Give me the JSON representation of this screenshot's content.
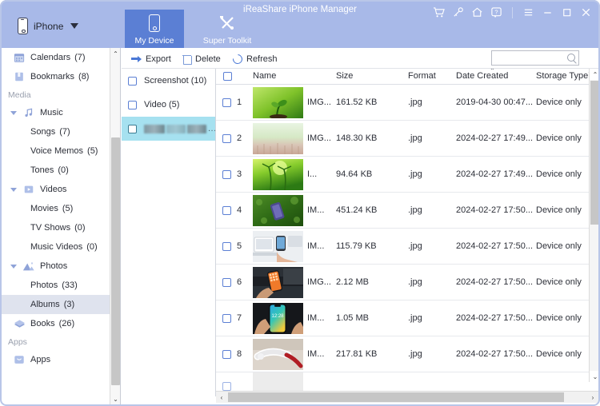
{
  "window": {
    "title": "iReaShare iPhone Manager",
    "accent": "#5b7fd4",
    "titlebar_bg": "#a8b9e8",
    "selection_blue": "#a6e1f0",
    "icons": [
      {
        "name": "cart-icon",
        "label": "Store"
      },
      {
        "name": "key-icon",
        "label": "Register"
      },
      {
        "name": "home-icon",
        "label": "Home"
      },
      {
        "name": "help-icon",
        "label": "Help"
      },
      {
        "name": "menu-icon",
        "label": "Menu"
      },
      {
        "name": "minimize-icon",
        "label": "Minimize"
      },
      {
        "name": "maximize-icon",
        "label": "Maximize"
      },
      {
        "name": "close-icon",
        "label": "Close"
      }
    ]
  },
  "device": {
    "name": "iPhone",
    "icon": "phone-icon",
    "dropdown_icon": "caret-down-icon"
  },
  "tabs": [
    {
      "id": "my-device",
      "label": "My Device",
      "icon": "phone-icon",
      "active": true
    },
    {
      "id": "super-toolkit",
      "label": "Super Toolkit",
      "icon": "tools-icon",
      "active": false
    }
  ],
  "sidebar": {
    "items": [
      {
        "label": "Calendars",
        "count": "(7)",
        "icon": "calendar-icon",
        "indent": 1,
        "twisty": false,
        "selected": false
      },
      {
        "label": "Bookmarks",
        "count": "(8)",
        "icon": "bookmark-icon",
        "indent": 1,
        "twisty": false,
        "selected": false
      },
      {
        "group": "Media"
      },
      {
        "label": "Music",
        "count": "",
        "icon": "music-icon",
        "indent": 0,
        "twisty": true,
        "selected": false
      },
      {
        "label": "Songs",
        "count": "(7)",
        "icon": "",
        "indent": 2,
        "twisty": false,
        "selected": false
      },
      {
        "label": "Voice Memos",
        "count": "(5)",
        "icon": "",
        "indent": 2,
        "twisty": false,
        "selected": false
      },
      {
        "label": "Tones",
        "count": "(0)",
        "icon": "",
        "indent": 2,
        "twisty": false,
        "selected": false
      },
      {
        "label": "Videos",
        "count": "",
        "icon": "video-icon",
        "indent": 0,
        "twisty": true,
        "selected": false
      },
      {
        "label": "Movies",
        "count": "(5)",
        "icon": "",
        "indent": 2,
        "twisty": false,
        "selected": false
      },
      {
        "label": "TV Shows",
        "count": "(0)",
        "icon": "",
        "indent": 2,
        "twisty": false,
        "selected": false
      },
      {
        "label": "Music Videos",
        "count": "(0)",
        "icon": "",
        "indent": 2,
        "twisty": false,
        "selected": false
      },
      {
        "label": "Photos",
        "count": "",
        "icon": "photos-icon",
        "indent": 0,
        "twisty": true,
        "selected": false
      },
      {
        "label": "Photos",
        "count": "(33)",
        "icon": "",
        "indent": 2,
        "twisty": false,
        "selected": false
      },
      {
        "label": "Albums",
        "count": "(3)",
        "icon": "",
        "indent": 2,
        "twisty": false,
        "selected": true
      },
      {
        "label": "Books",
        "count": "(26)",
        "icon": "books-icon",
        "indent": 1,
        "twisty": false,
        "selected": false
      },
      {
        "group": "Apps"
      },
      {
        "label": "Apps",
        "count": "",
        "icon": "apps-icon",
        "indent": 1,
        "twisty": false,
        "selected": false
      }
    ]
  },
  "toolbar": {
    "export_label": "Export",
    "delete_label": "Delete",
    "refresh_label": "Refresh",
    "search_value": "",
    "search_placeholder": ""
  },
  "albums": [
    {
      "label": "Screenshot (10)",
      "checked": false,
      "selected": false,
      "redacted": false
    },
    {
      "label": "Video (5)",
      "checked": false,
      "selected": false,
      "redacted": false
    },
    {
      "label": "",
      "checked": false,
      "selected": true,
      "redacted": true,
      "trailing": "..."
    }
  ],
  "table": {
    "columns": [
      {
        "key": "name",
        "label": "Name",
        "sorted": false
      },
      {
        "key": "size",
        "label": "Size",
        "sorted": false
      },
      {
        "key": "format",
        "label": "Format",
        "sorted": false
      },
      {
        "key": "date",
        "label": "Date Created",
        "sorted": true,
        "sort_dir": "asc"
      },
      {
        "key": "storage",
        "label": "Storage Type",
        "sorted": true,
        "sort_dir": "asc"
      }
    ],
    "rows": [
      {
        "index": "1",
        "name": "IMG...",
        "size": "161.52 KB",
        "format": ".jpg",
        "date": "2019-04-30 00:47...",
        "storage": "Device only",
        "thumb": "seedling-green",
        "checked": false
      },
      {
        "index": "2",
        "name": "IMG...",
        "size": "148.30 KB",
        "format": ".jpg",
        "date": "2024-02-27 17:49...",
        "storage": "Device only",
        "thumb": "wheat-field",
        "checked": false
      },
      {
        "index": "3",
        "name": "I...",
        "size": "94.64 KB",
        "format": ".jpg",
        "date": "2024-02-27 17:49...",
        "storage": "Device only",
        "thumb": "grass-sprout",
        "checked": false
      },
      {
        "index": "4",
        "name": "IM...",
        "size": "451.24 KB",
        "format": ".jpg",
        "date": "2024-02-27 17:50...",
        "storage": "Device only",
        "thumb": "phone-on-grass",
        "checked": false
      },
      {
        "index": "5",
        "name": "IM...",
        "size": "115.79 KB",
        "format": ".jpg",
        "date": "2024-02-27 17:50...",
        "storage": "Device only",
        "thumb": "desk-phone-hand",
        "checked": false
      },
      {
        "index": "6",
        "name": "IMG...",
        "size": "2.12 MB",
        "format": ".jpg",
        "date": "2024-02-27 17:50...",
        "storage": "Device only",
        "thumb": "dark-phone-hand",
        "checked": false
      },
      {
        "index": "7",
        "name": "IM...",
        "size": "1.05 MB",
        "format": ".jpg",
        "date": "2024-02-27 17:50...",
        "storage": "Device only",
        "thumb": "blue-screen-phone",
        "checked": false
      },
      {
        "index": "8",
        "name": "IM...",
        "size": "217.81 KB",
        "format": ".jpg",
        "date": "2024-02-27 17:50...",
        "storage": "Device only",
        "thumb": "red-cable",
        "checked": false
      },
      {
        "index": "",
        "name": "",
        "size": "",
        "format": "",
        "date": "",
        "storage": "",
        "thumb": "red-app-icon",
        "checked": false,
        "partial": true
      }
    ]
  },
  "scrollbars": {
    "up_glyph": "⌃",
    "down_glyph": "⌄",
    "left_glyph": "‹",
    "right_glyph": "›"
  }
}
